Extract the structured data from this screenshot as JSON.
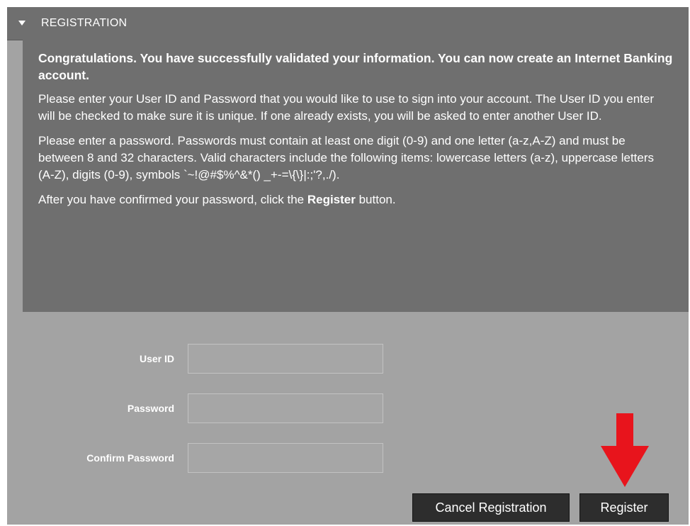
{
  "panel": {
    "title": "REGISTRATION",
    "caret_icon": "caret-down-icon"
  },
  "info": {
    "lead": "Congratulations. You have successfully validated your information. You can now create an Internet Banking account.",
    "paragraph_user_id": "Please enter your User ID and Password that you would like to use to sign into your account. The User ID you enter will be checked to make sure it is unique. If one already exists, you will be asked to enter another User ID.",
    "paragraph_password": "Please enter a password. Passwords must contain at least one digit (0-9) and one letter (a-z,A-Z) and must be between 8 and 32 characters. Valid characters include the following items: lowercase letters (a-z), uppercase letters (A-Z), digits (0-9), symbols `~!@#$%^&*() _+-=\\{\\}|:;'?,./).",
    "paragraph_confirm_before": "After you have confirmed your password, click the ",
    "paragraph_confirm_bold": "Register",
    "paragraph_confirm_after": " button."
  },
  "form": {
    "user_id": {
      "label": "User ID",
      "value": ""
    },
    "password": {
      "label": "Password",
      "value": ""
    },
    "confirm_password": {
      "label": "Confirm Password",
      "value": ""
    }
  },
  "buttons": {
    "cancel_label": "Cancel Registration",
    "register_label": "Register"
  },
  "annotation": {
    "arrow_icon": "red-arrow-down-icon",
    "arrow_color": "#e8141c"
  },
  "colors": {
    "panel_bg": "#a3a3a3",
    "header_bg": "#6f6f6f",
    "info_bg": "#6f6f6f",
    "button_bg": "#2d2d2d"
  }
}
